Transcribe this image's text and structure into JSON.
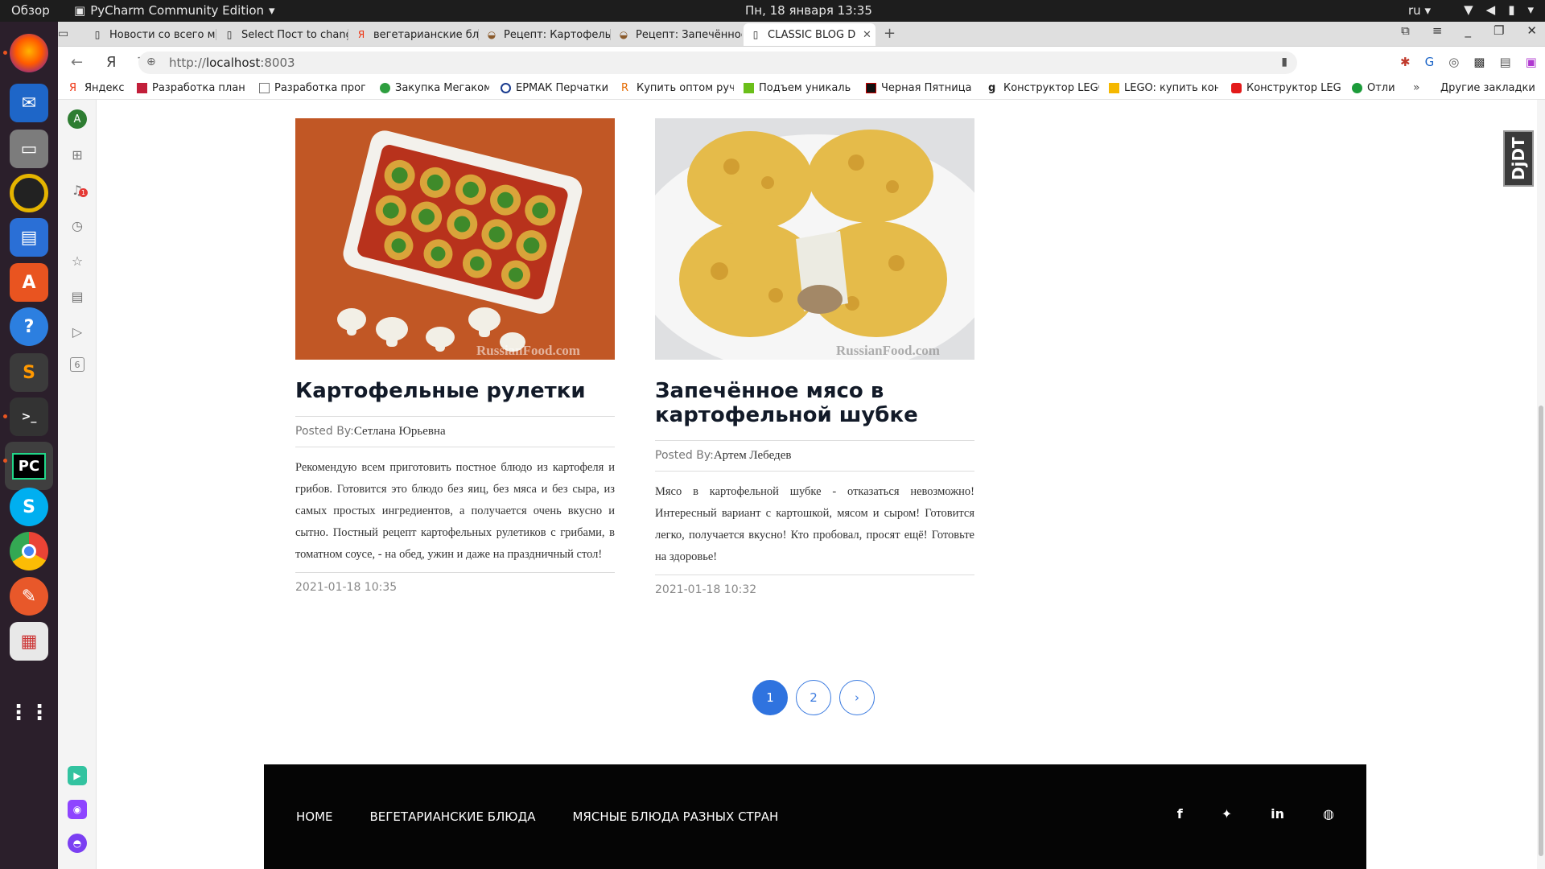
{
  "os": {
    "activities": "Обзор",
    "app_name": "PyCharm Community Edition",
    "clock": "Пн, 18 января  13:35",
    "lang": "ru"
  },
  "browser": {
    "tabs": [
      {
        "title": "Новости со всего мира"
      },
      {
        "title": "Select Пост to change | Dja"
      },
      {
        "title": "вегетарианские блюда —"
      },
      {
        "title": "Рецепт: Картофельные ру"
      },
      {
        "title": "Рецепт: Запечённое мясо"
      },
      {
        "title": "CLASSIC BLOG DESIGN:"
      }
    ],
    "url_prefix": "http://",
    "url_host": "localhost",
    "url_port": ":8003",
    "bookmarks": [
      {
        "label": "Яндекс"
      },
      {
        "label": "Разработка план"
      },
      {
        "label": "Разработка прог"
      },
      {
        "label": "Закупка Мегаком"
      },
      {
        "label": "ЕРМАК Перчатки"
      },
      {
        "label": "Купить оптом руч"
      },
      {
        "label": "Подъем уникаль"
      },
      {
        "label": "Черная Пятница"
      },
      {
        "label": "Конструктор LEGO"
      },
      {
        "label": "LEGO: купить кон"
      },
      {
        "label": "Конструктор LEGO"
      },
      {
        "label": "Отли"
      }
    ],
    "other_bookmarks": "Другие закладки",
    "sidebar_avatar": "A",
    "sidebar_badge": "1",
    "sidebar_counter": "6"
  },
  "posts": [
    {
      "title": "Картофельные рулетки",
      "posted_by_label": "Posted By:",
      "author": "Сетлана Юрьевна",
      "description": "Рекомендую всем приготовить постное блюдо из картофеля и грибов. Готовится это блюдо без яиц, без мяса и без сыра, из самых простых ингредиентов, а получается очень вкусно и сытно. Постный рецепт картофельных рулетиков с грибами, в томатном соусе, - на обед, ужин и даже на праздничный стол!",
      "date": "2021-01-18 10:35",
      "watermark": "RussianFood.com"
    },
    {
      "title": "Запечённое мясо в картофельной шубке",
      "posted_by_label": "Posted By:",
      "author": "Артем Лебедев",
      "description": "Мясо в картофельной шубке - отказаться невозможно! Интересный вариант с картошкой, мясом и сыром! Готовится легко, получается вкусно! Кто пробовал, просят ещё! Готовьте на здоровье!",
      "date": "2021-01-18 10:32",
      "watermark": "RussianFood.com"
    }
  ],
  "pagination": {
    "pages": [
      "1",
      "2"
    ],
    "next": "›",
    "current": "1"
  },
  "footer": {
    "nav": [
      "HOME",
      "ВЕГЕТАРИАНСКИЕ БЛЮДА",
      "МЯСНЫЕ БЛЮДА РАЗНЫХ СТРАН"
    ],
    "social": [
      "facebook-icon",
      "twitter-icon",
      "linkedin-icon",
      "dribbble-icon"
    ]
  },
  "debug_toolbar": "DjDT",
  "colors": {
    "accent": "#2f73df",
    "footer_bg": "#050505",
    "dock_bg": "#2b1f2b"
  }
}
